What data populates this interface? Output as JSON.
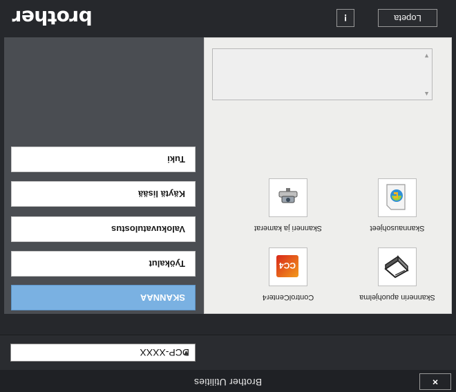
{
  "window": {
    "title": "Brother Utilities",
    "close_label": "×"
  },
  "model": {
    "selected": "DCP-XXXX"
  },
  "header": {
    "brand": "brother",
    "exit_label": "Lopeta",
    "info_label": "!"
  },
  "sidebar": {
    "items": [
      {
        "label": "SKANNAA",
        "active": true
      },
      {
        "label": "Työkalut",
        "active": false
      },
      {
        "label": "Valokuvatulostus",
        "active": false
      },
      {
        "label": "Käytä lisää",
        "active": false
      },
      {
        "label": "Tuki",
        "active": false
      }
    ]
  },
  "scan_functions": [
    {
      "label": "Skannerin apuohjelma",
      "icon": "scanner-utility-icon"
    },
    {
      "label": "ControlCenter4",
      "icon": "controlcenter4-icon"
    },
    {
      "label": "Skannausohjeet",
      "icon": "scan-help-icon"
    },
    {
      "label": "Skanneri ja kamerat",
      "icon": "scanner-camera-icon"
    }
  ]
}
